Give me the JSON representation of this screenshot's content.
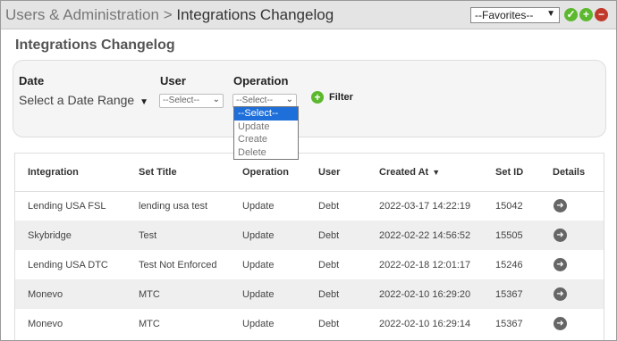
{
  "breadcrumb": {
    "parent": "Users & Administration",
    "separator": ">",
    "current": "Integrations Changelog"
  },
  "favorites": {
    "selected": "--Favorites--"
  },
  "panel": {
    "title": "Integrations Changelog"
  },
  "filters": {
    "date_label": "Date",
    "date_value": "Select a Date Range",
    "user_label": "User",
    "user_value": "--Select--",
    "operation_label": "Operation",
    "operation_value": "--Select--",
    "operation_options": [
      "--Select--",
      "Update",
      "Create",
      "Delete"
    ],
    "filter_button": "Filter"
  },
  "table": {
    "headers": [
      "Integration",
      "Set Title",
      "Operation",
      "User",
      "Created At",
      "Set ID",
      "Details"
    ],
    "rows": [
      {
        "integration": "Lending USA FSL",
        "set_title": "lending usa test",
        "operation": "Update",
        "user": "Debt",
        "created_at": "2022-03-17 14:22:19",
        "set_id": "15042"
      },
      {
        "integration": "Skybridge",
        "set_title": "Test",
        "operation": "Update",
        "user": "Debt",
        "created_at": "2022-02-22 14:56:52",
        "set_id": "15505"
      },
      {
        "integration": "Lending USA DTC",
        "set_title": "Test Not Enforced",
        "operation": "Update",
        "user": "Debt",
        "created_at": "2022-02-18 12:01:17",
        "set_id": "15246"
      },
      {
        "integration": "Monevo",
        "set_title": "MTC",
        "operation": "Update",
        "user": "Debt",
        "created_at": "2022-02-10 16:29:20",
        "set_id": "15367"
      },
      {
        "integration": "Monevo",
        "set_title": "MTC",
        "operation": "Update",
        "user": "Debt",
        "created_at": "2022-02-10 16:29:14",
        "set_id": "15367"
      }
    ]
  },
  "colors": {
    "accent_blue": "#1e6fd9",
    "add_green": "#5cb82e",
    "remove_red": "#c0392b"
  }
}
